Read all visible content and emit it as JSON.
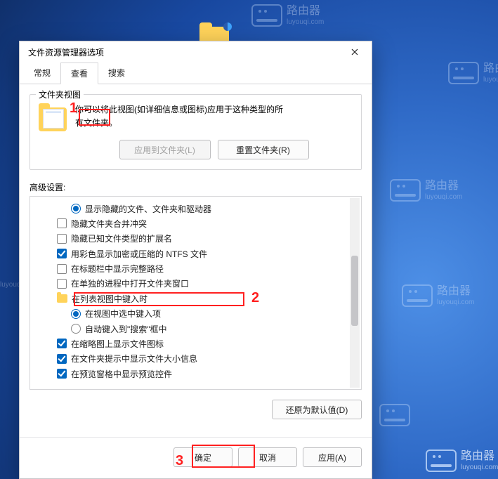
{
  "dialog": {
    "title": "文件资源管理器选项",
    "tabs": {
      "general": "常规",
      "view": "查看",
      "search": "搜索"
    },
    "folder_view": {
      "legend": "文件夹视图",
      "desc_line1": "你可以将此视图(如详细信息或图标)应用于这种类型的所",
      "desc_line2": "有文件夹。",
      "apply_to_folders": "应用到文件夹(L)",
      "reset_folders": "重置文件夹(R)"
    },
    "advanced": {
      "label": "高级设置:",
      "items": [
        {
          "kind": "radio",
          "indent": 2,
          "checked": true,
          "text": "显示隐藏的文件、文件夹和驱动器"
        },
        {
          "kind": "checkbox",
          "indent": 1,
          "checked": false,
          "text": "隐藏文件夹合并冲突"
        },
        {
          "kind": "checkbox",
          "indent": 1,
          "checked": false,
          "text": "隐藏已知文件类型的扩展名"
        },
        {
          "kind": "checkbox",
          "indent": 1,
          "checked": true,
          "text": "用彩色显示加密或压缩的 NTFS 文件"
        },
        {
          "kind": "checkbox",
          "indent": 1,
          "checked": false,
          "text": "在标题栏中显示完整路径"
        },
        {
          "kind": "checkbox",
          "indent": 1,
          "checked": false,
          "text": "在单独的进程中打开文件夹窗口"
        },
        {
          "kind": "folder",
          "indent": 1,
          "text": "在列表视图中键入时"
        },
        {
          "kind": "radio",
          "indent": 2,
          "checked": true,
          "text": "在视图中选中键入项"
        },
        {
          "kind": "radio",
          "indent": 2,
          "checked": false,
          "text": "自动键入到\"搜索\"框中"
        },
        {
          "kind": "checkbox",
          "indent": 1,
          "checked": true,
          "text": "在缩略图上显示文件图标"
        },
        {
          "kind": "checkbox",
          "indent": 1,
          "checked": true,
          "text": "在文件夹提示中显示文件大小信息"
        },
        {
          "kind": "checkbox",
          "indent": 1,
          "checked": true,
          "text": "在预览窗格中显示预览控件"
        }
      ],
      "restore_defaults": "还原为默认值(D)"
    },
    "footer": {
      "ok": "确定",
      "cancel": "取消",
      "apply": "应用(A)"
    }
  },
  "watermark": {
    "zh": "路由器",
    "url": "luyouqi.com"
  },
  "annotations": {
    "n1": "1",
    "n2": "2",
    "n3": "3"
  }
}
